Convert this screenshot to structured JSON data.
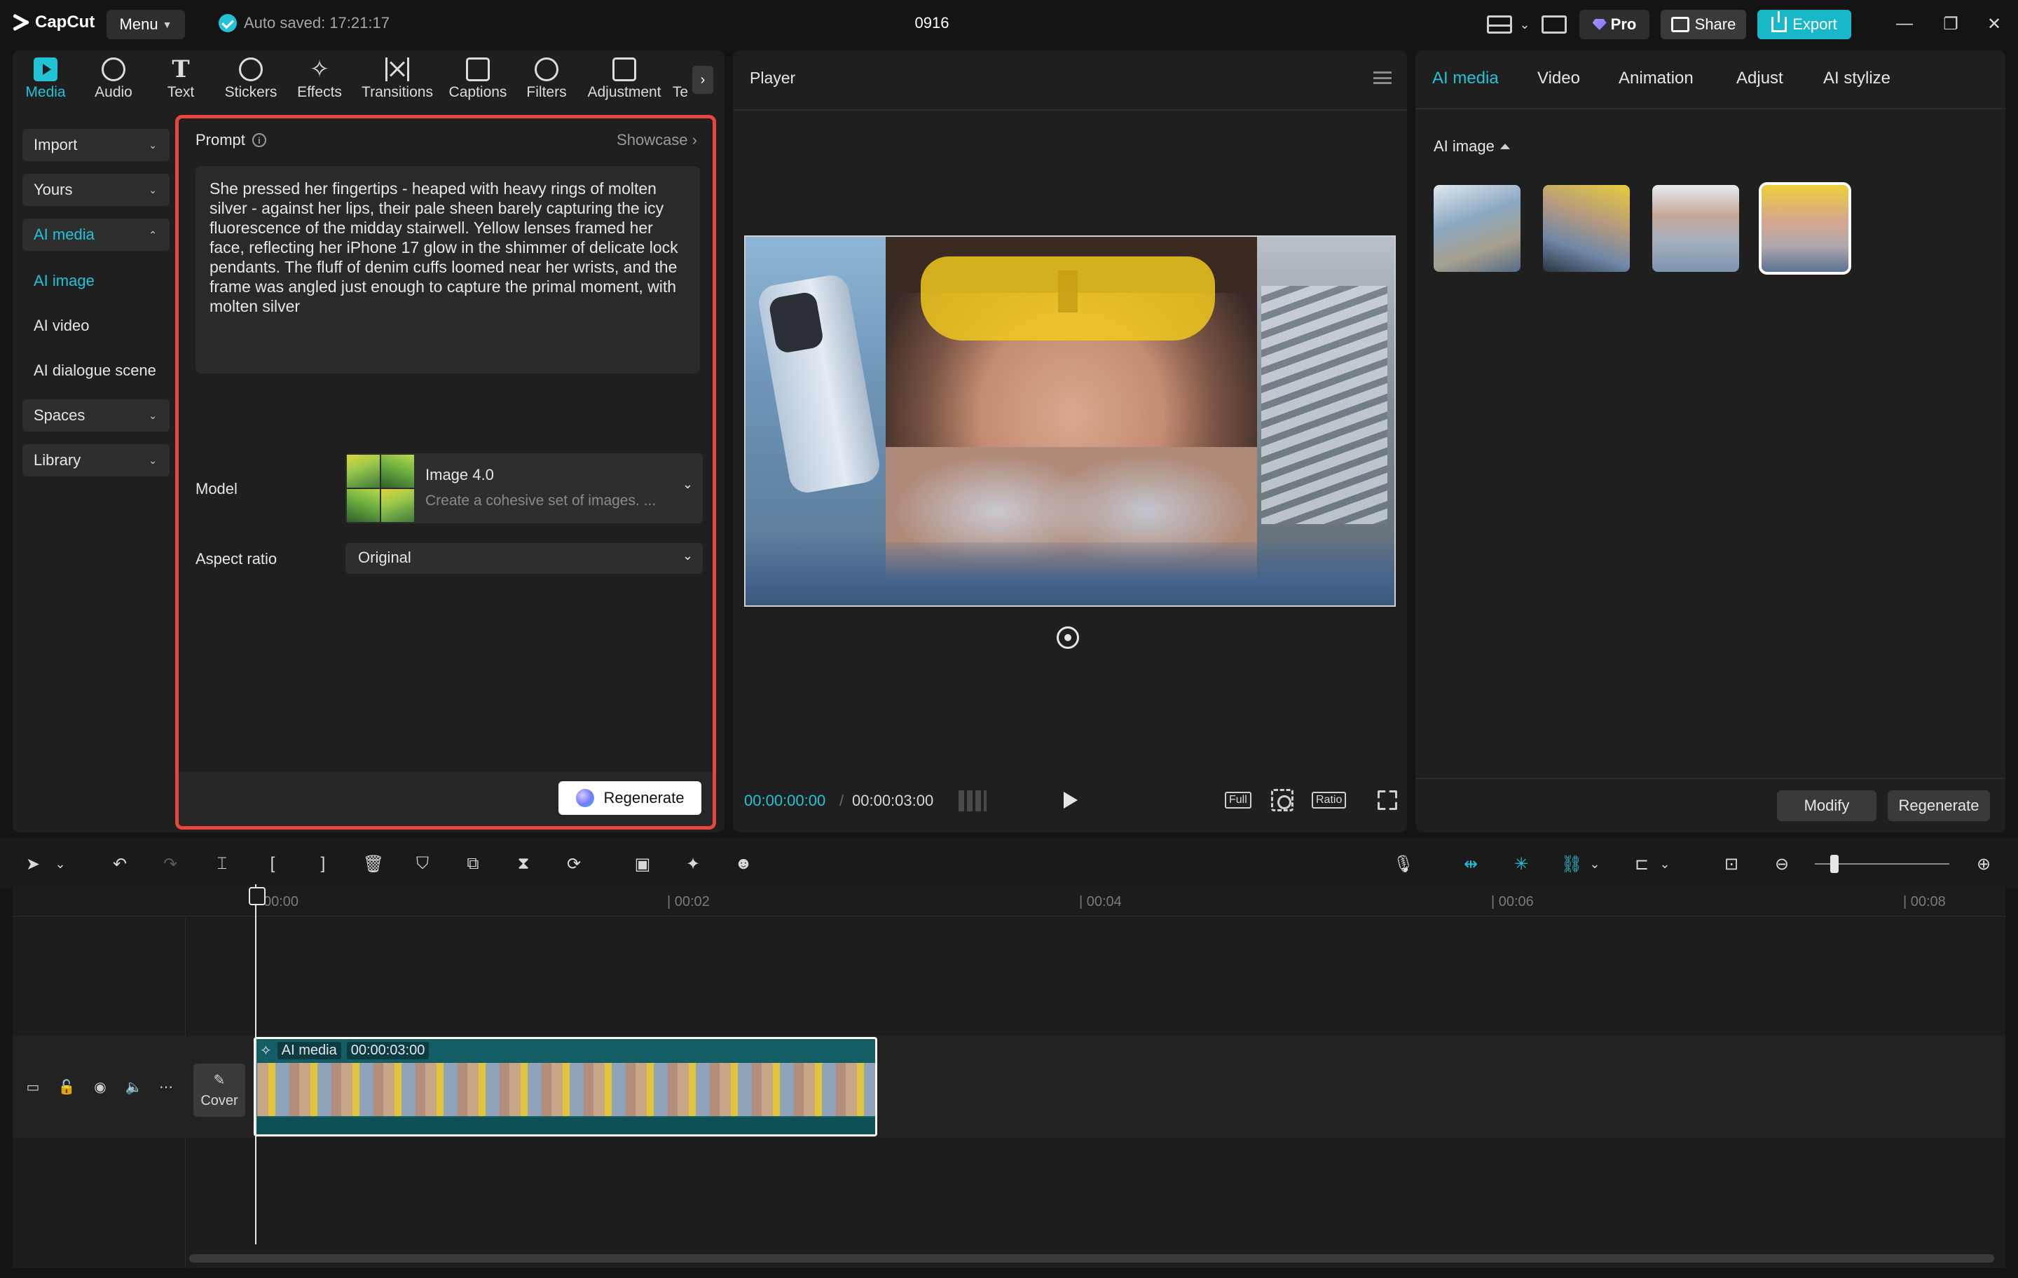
{
  "app": {
    "name": "CapCut",
    "menu_label": "Menu",
    "autosave": "Auto saved: 17:21:17",
    "project_title": "0916"
  },
  "titlebar": {
    "pro_label": "Pro",
    "share_label": "Share",
    "export_label": "Export"
  },
  "tooltabs": [
    {
      "label": "Media",
      "active": true
    },
    {
      "label": "Audio"
    },
    {
      "label": "Text"
    },
    {
      "label": "Stickers"
    },
    {
      "label": "Effects"
    },
    {
      "label": "Transitions"
    },
    {
      "label": "Captions"
    },
    {
      "label": "Filters"
    },
    {
      "label": "Adjustment"
    },
    {
      "label": "Te"
    }
  ],
  "leftnav": {
    "import": "Import",
    "yours": "Yours",
    "ai_media": "AI media",
    "ai_image": "AI image",
    "ai_video": "AI video",
    "ai_dialogue": "AI dialogue scene",
    "spaces": "Spaces",
    "library": "Library"
  },
  "prompt": {
    "label": "Prompt",
    "showcase": "Showcase",
    "text": "She pressed her fingertips - heaped with heavy rings of molten silver - against her lips, their pale sheen barely capturing the icy fluorescence of the midday stairwell. Yellow lenses framed her face, reflecting her iPhone 17 glow in the shimmer of delicate lock pendants. The fluff of denim cuffs loomed near her wrists, and the frame was angled just enough to capture the primal moment, with molten silver",
    "model_label": "Model",
    "model_name": "Image 4.0",
    "model_desc": "Create a cohesive set of images. ...",
    "aspect_label": "Aspect ratio",
    "aspect_value": "Original",
    "regenerate": "Regenerate"
  },
  "player": {
    "title": "Player",
    "current_time": "00:00:00:00",
    "separator": "/",
    "duration": "00:00:03:00",
    "full_label": "Full",
    "ratio_label": "Ratio"
  },
  "right": {
    "tabs": [
      "AI media",
      "Video",
      "Animation",
      "Adjust",
      "AI stylize"
    ],
    "section_label": "AI image",
    "thumb_count_visible": 4,
    "selected_thumb": 4,
    "modify": "Modify",
    "regenerate": "Regenerate"
  },
  "timeline": {
    "ruler": [
      "00:00",
      "| 00:02",
      "| 00:04",
      "| 00:06",
      "| 00:08"
    ],
    "clip_label": "AI media",
    "clip_duration": "00:00:03:00",
    "cover_label": "Cover",
    "zoom_level": 0.12
  },
  "colors": {
    "accent": "#22c3d6",
    "export": "#19b8c9",
    "highlight_border": "#e8453c",
    "clip": "#135d64"
  }
}
